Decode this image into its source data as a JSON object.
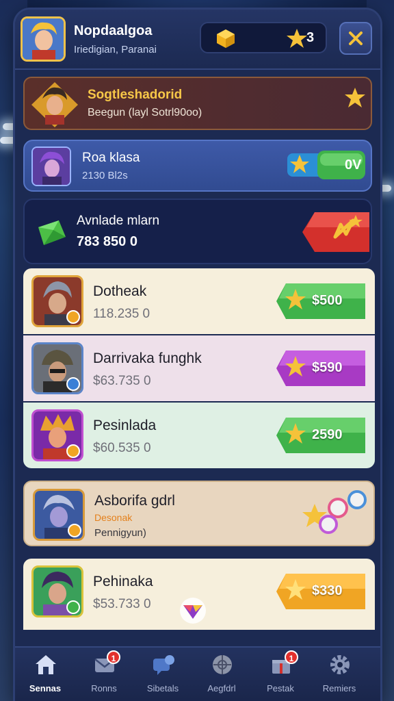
{
  "header": {
    "player_name": "Nopdaalgoa",
    "player_subtitle": "Iriedigian, Paranai",
    "currency_count": "3"
  },
  "banner": {
    "title": "Sogtleshadorid",
    "subtitle": "Beegun (layl Sotrl90oo)"
  },
  "featured": {
    "title": "Roa klasa",
    "subtitle": "2130 Bl2s",
    "button_label": "0V"
  },
  "available": {
    "title": "Avnlade mlarn",
    "value": "783 850 0"
  },
  "items": [
    {
      "title": "Dotheak",
      "price": "118.235 0",
      "button_label": "$500",
      "button_color": "#3fb24a"
    },
    {
      "title": "Darrivaka funghk",
      "price": "$63.735 0",
      "button_label": "$590",
      "button_color": "#a83ac4"
    },
    {
      "title": "Pesinlada",
      "price": "$60.535 0",
      "button_label": "2590",
      "button_color": "#3fb24a"
    },
    {
      "title": "Asborifa gdrl",
      "tag": "Desonak",
      "subtitle": "Pennigyun)"
    },
    {
      "title": "Pehinaka",
      "price": "$53.733 0",
      "button_label": "$330",
      "button_color": "#f0a524"
    }
  ],
  "nav": [
    {
      "label": "Sennas",
      "icon": "home-icon",
      "active": true
    },
    {
      "label": "Ronns",
      "icon": "mail-icon",
      "badge": "1"
    },
    {
      "label": "Sibetals",
      "icon": "chat-icon"
    },
    {
      "label": "Aegfdrl",
      "icon": "ball-icon"
    },
    {
      "label": "Pestak",
      "icon": "gift-icon",
      "badge": "1"
    },
    {
      "label": "Remiers",
      "icon": "gear-icon"
    }
  ],
  "colors": {
    "accent_gold": "#f5c23a",
    "panel_dark": "#1c2a52",
    "green_button": "#3fb24a",
    "purple_button": "#a83ac4",
    "orange_button": "#f0a524",
    "red_button": "#d3302c"
  }
}
